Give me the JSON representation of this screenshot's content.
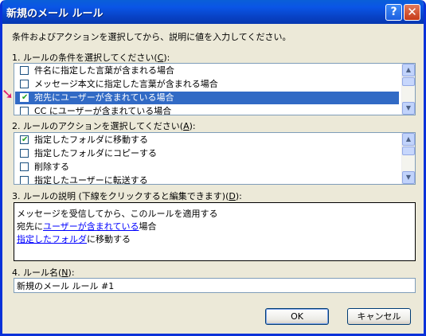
{
  "window": {
    "title": "新規のメール ルール",
    "help_glyph": "?",
    "close_glyph": "✕"
  },
  "instruction": "条件およびアクションを選択してから、説明に値を入力してください。",
  "step1": {
    "label_prefix": "1. ルールの条件を選択してください(",
    "accel": "C",
    "label_suffix": "):",
    "items": [
      {
        "text": "件名に指定した言葉が含まれる場合",
        "checked": false,
        "selected": false
      },
      {
        "text": "メッセージ本文に指定した言葉が含まれる場合",
        "checked": false,
        "selected": false
      },
      {
        "text": "宛先にユーザーが含まれている場合",
        "checked": true,
        "selected": true
      },
      {
        "text": "CC にユーザーが含まれている場合",
        "checked": false,
        "selected": false
      }
    ]
  },
  "step2": {
    "label_prefix": "2. ルールのアクションを選択してください(",
    "accel": "A",
    "label_suffix": "):",
    "items": [
      {
        "text": "指定したフォルダに移動する",
        "checked": true
      },
      {
        "text": "指定したフォルダにコピーする",
        "checked": false
      },
      {
        "text": "削除する",
        "checked": false
      },
      {
        "text": "指定したユーザーに転送する",
        "checked": false
      }
    ]
  },
  "step3": {
    "label_prefix": "3. ルールの説明 (下線をクリックすると編集できます)(",
    "accel": "D",
    "label_suffix": "):",
    "line1": "メッセージを受信してから、このルールを適用する",
    "line2_pre": "宛先に",
    "line2_link": "ユーザーが含まれている",
    "line2_post": "場合",
    "line3_link": "指定したフォルダ",
    "line3_post": "に移動する"
  },
  "step4": {
    "label_prefix": "4. ルール名(",
    "accel": "N",
    "label_suffix": "):",
    "value": "新規のメール ルール #1"
  },
  "buttons": {
    "ok": "OK",
    "cancel": "キャンセル"
  },
  "pointer_glyph": "➘",
  "check_glyph": "✔",
  "scroll_up_glyph": "▲",
  "scroll_down_glyph": "▼"
}
